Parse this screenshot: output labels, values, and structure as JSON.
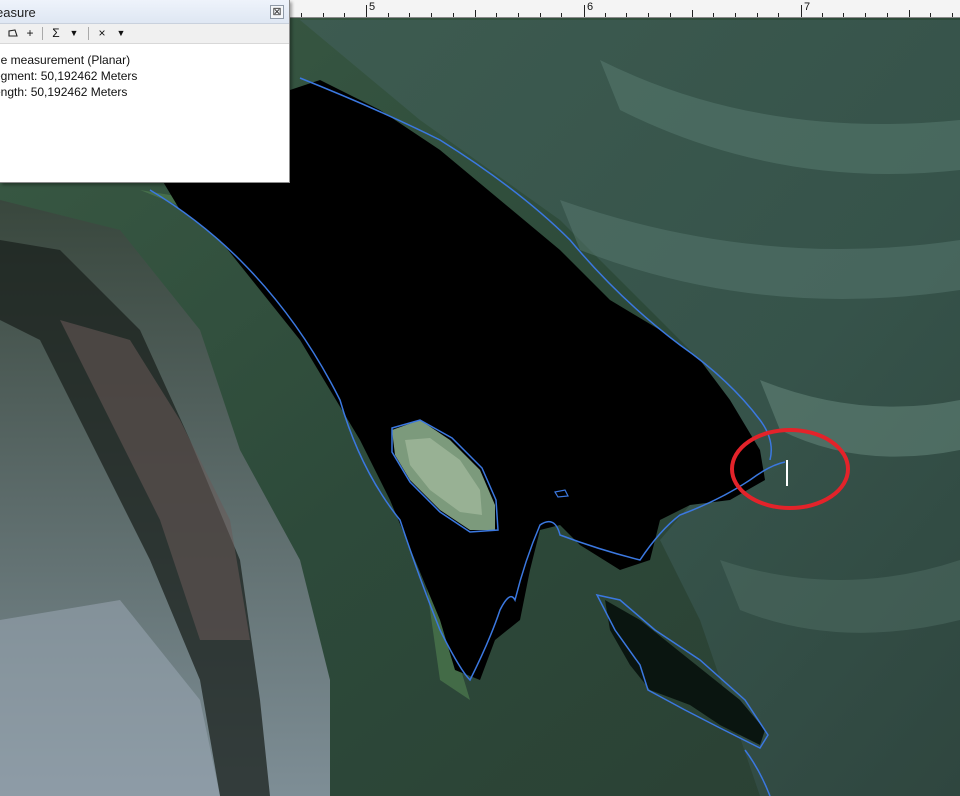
{
  "measure_window": {
    "title": "easure",
    "close_glyph": "⊠",
    "toolbar": {
      "line_icon": "measure-line-icon",
      "area_icon": "measure-area-icon",
      "feature_icon": "measure-feature-icon",
      "sum_icon": "sum-icon",
      "units_dropdown_icon": "chevron-down-icon",
      "clear_icon": "clear-icon",
      "options_dropdown_icon": "chevron-down-icon",
      "feature_glyph": "+",
      "sum_glyph": "Σ",
      "dropdown_glyph": "▼",
      "clear_glyph": "×"
    },
    "result_lines": [
      "ne measurement (Planar)",
      "egment: 50,192462 Meters",
      "ength: 50,192462 Meters"
    ]
  },
  "ruler": {
    "labels": [
      "5",
      "6",
      "7"
    ]
  },
  "map": {
    "outline_color": "#3b78e0",
    "highlight_color": "#e3232a",
    "water_color": "#000000"
  }
}
